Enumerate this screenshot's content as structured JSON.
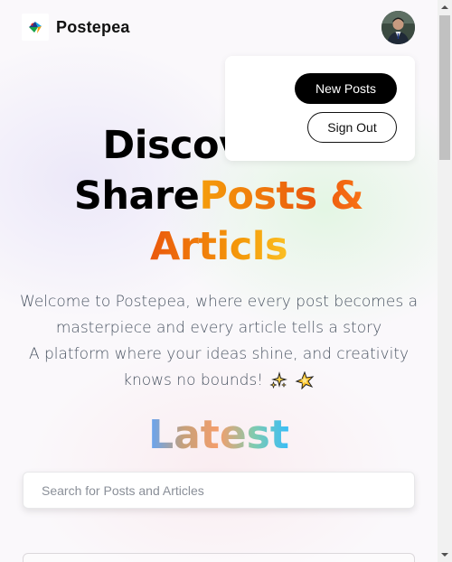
{
  "nav": {
    "brand": "Postepea",
    "logo_icon": "postepea-logo-icon",
    "avatar_icon": "user-avatar"
  },
  "hero": {
    "line1": "Discover &",
    "line2_plain": "Share",
    "line2_accent": "Posts &",
    "line3_accent": "Articls"
  },
  "menu": {
    "new_posts_label": "New Posts",
    "sign_out_label": "Sign Out"
  },
  "description": {
    "line1": "Welcome to Postepea, where every post becomes a masterpiece and every article tells a story",
    "line2": "A platform where your ideas shine, and creativity knows no bounds!",
    "emoji": [
      "sparkles-icon",
      "glowing-star-icon"
    ]
  },
  "latest": {
    "heading": "Latest"
  },
  "search": {
    "placeholder": "Search for Posts and Articles",
    "value": ""
  },
  "colors": {
    "accent_orange": "#ea580c",
    "accent_amber": "#f59e0b",
    "button_black": "#000000"
  }
}
